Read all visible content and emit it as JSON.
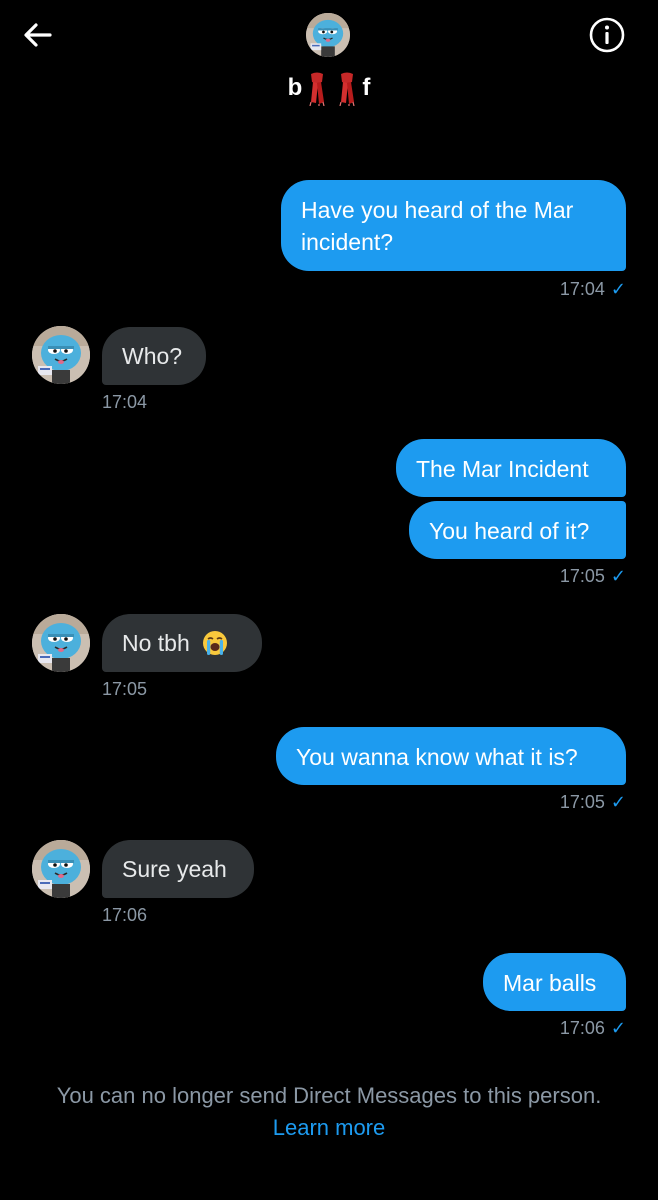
{
  "header": {
    "conversation_name_left": "b",
    "conversation_name_right": "f",
    "back_icon": "arrow-left-icon",
    "info_icon": "info-circle-icon",
    "name_emoji": "scarf"
  },
  "messages": [
    {
      "direction": "outgoing",
      "lines": [
        "Have you heard of the Mar",
        "incident?"
      ],
      "time": "17:04",
      "read": true
    },
    {
      "direction": "incoming",
      "lines": [
        "Who?"
      ],
      "time": "17:04"
    },
    {
      "direction": "outgoing",
      "lines": [
        "The Mar Incident"
      ]
    },
    {
      "direction": "outgoing",
      "lines": [
        "You heard of it?"
      ],
      "time": "17:05",
      "read": true
    },
    {
      "direction": "incoming",
      "lines": [
        "No tbh"
      ],
      "emoji": "loudly-crying-face",
      "time": "17:05"
    },
    {
      "direction": "outgoing",
      "lines": [
        "You wanna know what it is?"
      ],
      "time": "17:05",
      "read": true
    },
    {
      "direction": "incoming",
      "lines": [
        "Sure yeah"
      ],
      "time": "17:06"
    },
    {
      "direction": "outgoing",
      "lines": [
        "Mar balls"
      ],
      "time": "17:06",
      "read": true
    }
  ],
  "footer": {
    "notice": "You can no longer send Direct Messages to this person.",
    "link": "Learn more"
  },
  "colors": {
    "background": "#000000",
    "outgoing_bubble": "#1d9bf0",
    "incoming_bubble": "#2f3336",
    "timestamp": "#8b98a5",
    "link": "#1d9bf0"
  }
}
